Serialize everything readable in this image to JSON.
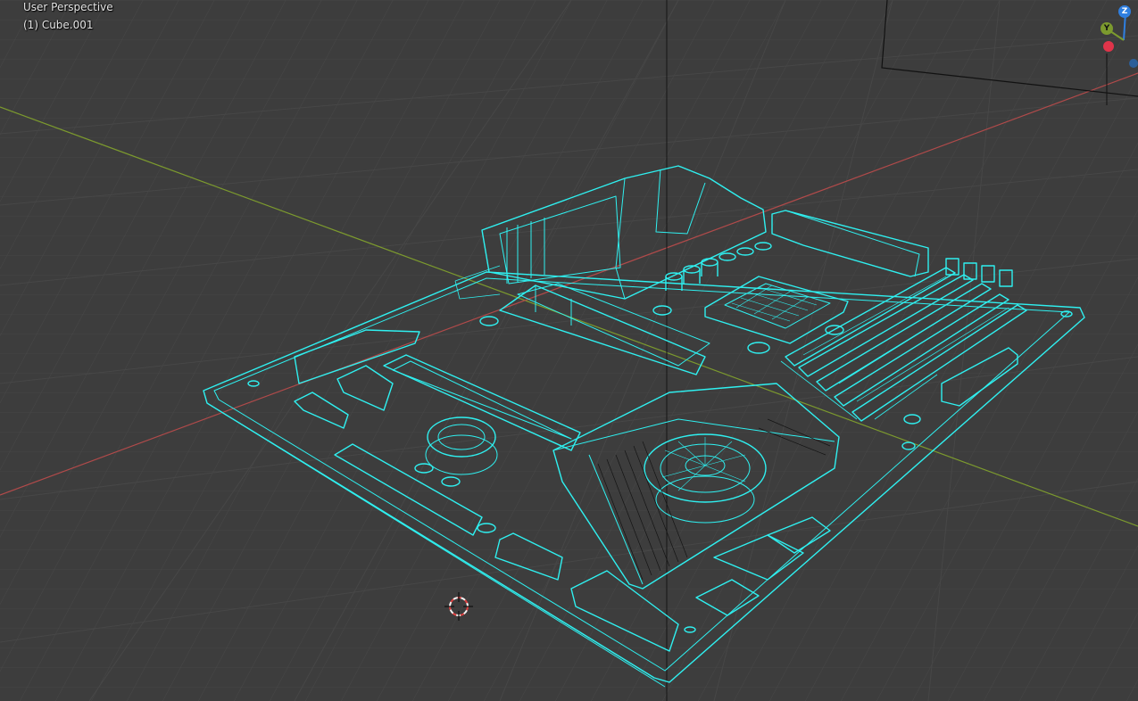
{
  "viewport": {
    "view_name": "User Perspective",
    "active_object": "(1) Cube.001",
    "background_color": "#3d3d3d",
    "wire_color": "#2ff0f0",
    "x_axis_color": "#b04a4a",
    "y_axis_color": "#7c9a2e"
  },
  "gizmo": {
    "z_label": "Z",
    "y_label": "Y",
    "z_color": "#2f7fe0",
    "y_color": "#7c9a2e",
    "x_color": "#e0344a"
  },
  "scene": {
    "object": "motherboard-wireframe",
    "icons": [
      "3d-cursor-icon",
      "navigation-gizmo"
    ]
  }
}
